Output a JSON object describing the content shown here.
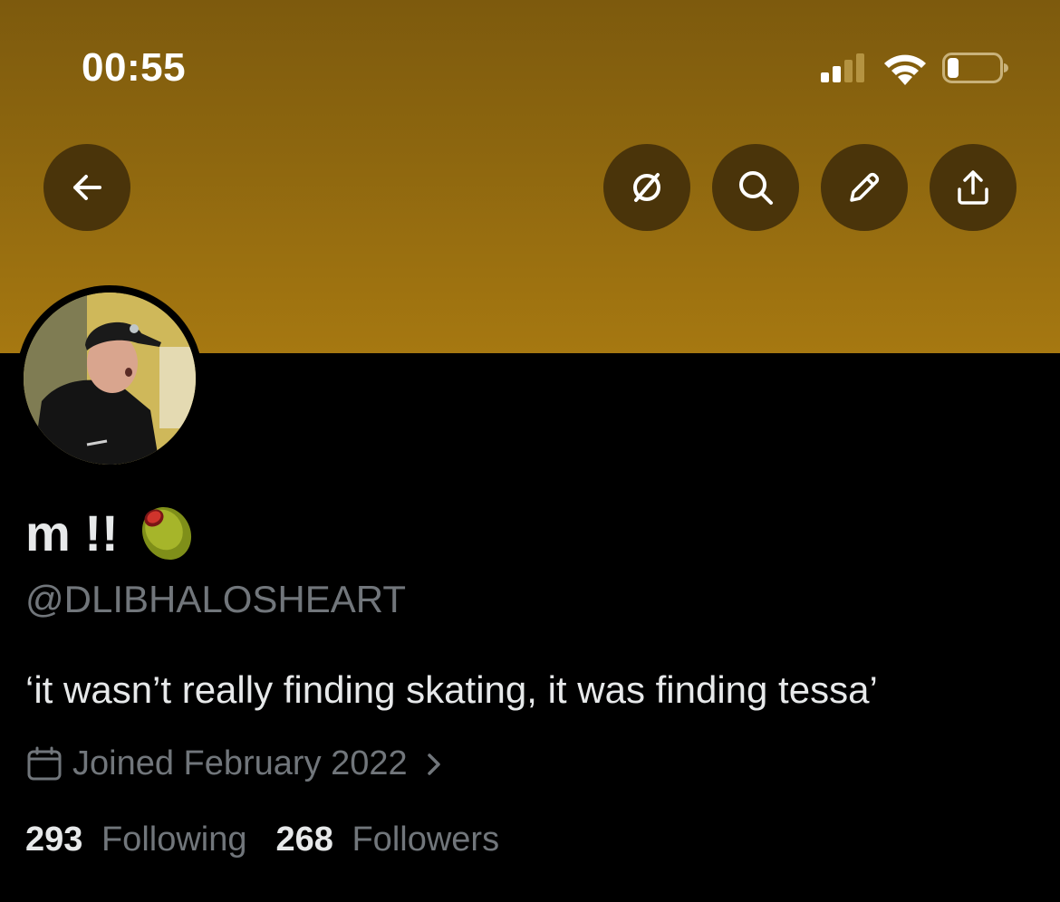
{
  "status_bar": {
    "time": "00:55",
    "icons": [
      "cellular-signal-icon",
      "wifi-icon",
      "battery-icon"
    ]
  },
  "header": {
    "banner_color": "#8e670f",
    "buttons": [
      {
        "name": "back-button",
        "icon": "arrow-left-icon"
      },
      {
        "name": "hide-button",
        "icon": "no-symbol-icon"
      },
      {
        "name": "search-button",
        "icon": "search-icon"
      },
      {
        "name": "edit-button",
        "icon": "pencil-icon"
      },
      {
        "name": "share-button",
        "icon": "share-icon"
      }
    ]
  },
  "profile": {
    "display_name": "m !!",
    "name_emoji": "olive-emoji",
    "handle": "@DLIBHALOSHEART",
    "bio": "‘it wasn’t really finding skating, it was finding tessa’",
    "joined": "Joined February 2022",
    "following_count": "293",
    "following_label": "Following",
    "followers_count": "268",
    "followers_label": "Followers"
  }
}
